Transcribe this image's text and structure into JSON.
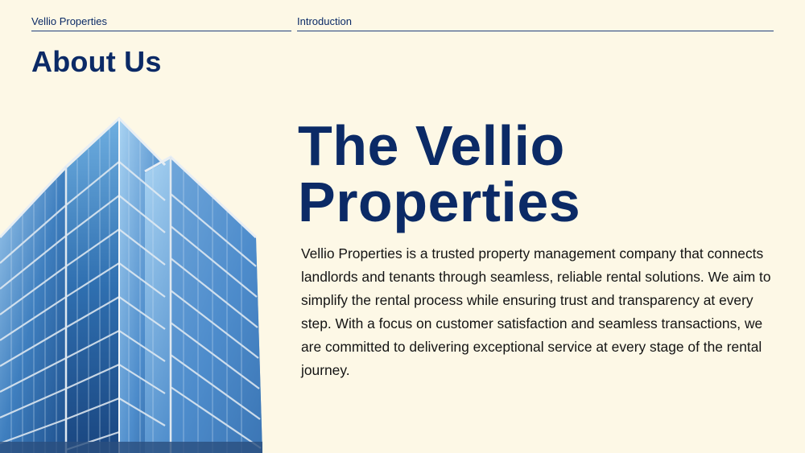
{
  "header": {
    "left_label": "Vellio Properties",
    "right_label": "Introduction"
  },
  "section_title": "About Us",
  "headline": {
    "line1": "The Vellio",
    "line2": "Properties"
  },
  "body": "Vellio Properties is a trusted property management company that connects landlords and tenants through seamless, reliable rental solutions. We aim to simplify the rental process while ensuring trust and transparency at every step. With a focus on customer satisfaction and seamless transactions, we are committed to delivering exceptional service at every stage of the rental journey.",
  "colors": {
    "background": "#fdf8e6",
    "brand_navy": "#0b2a66",
    "glass_blue": "#5d9fd6"
  },
  "image": {
    "icon": "office-building-image"
  }
}
